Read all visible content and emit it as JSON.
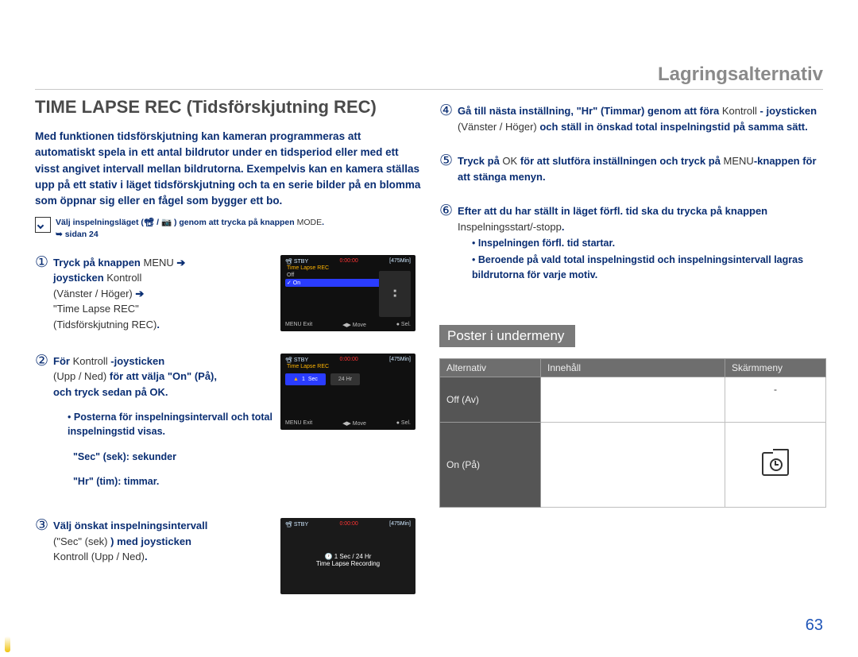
{
  "section_title": "Lagringsalternativ",
  "heading": "TIME LAPSE REC (Tidsförskjutning REC)",
  "intro": "Med funktionen tidsförskjutning kan kameran programmeras att automatiskt spela in ett antal bildrutor under en tidsperiod eller med ett visst angivet intervall mellan bildrutorna. Exempelvis kan en kamera ställas upp på ett stativ i läget tidsförskjutning och ta en serie bilder på en blomma som öppnar sig eller en fågel som bygger ett bo.",
  "note_prefix": "Välj inspelningsläget (",
  "note_mid": " / ",
  "note_suffix": " ) genom att trycka på knappen ",
  "note_mode": "MODE",
  "note_page": "➥ sidan 24",
  "steps": {
    "s1": {
      "a": "Tryck på knappen ",
      "menu": "MENU",
      "b": " ➔ ",
      "c": "joysticken ",
      "d": "Kontroll",
      "e": "(Vänster / Höger)",
      "f": " ➔ ",
      "g": "\"Time Lapse REC\"",
      "h": "(Tidsförskjutning REC)",
      "tail": "."
    },
    "s2": {
      "a": "För ",
      "b": "Kontroll",
      "c": " -joysticken",
      "d": "(Upp / Ned)",
      "e": " för att välja \"On\" (På),",
      "f": "och tryck sedan på OK.",
      "bul1": "Posterna för inspelningsintervall och total inspelningstid visas.",
      "bul2": "\"Sec\" (sek): sekunder",
      "bul3": "\"Hr\" (tim): timmar."
    },
    "s3": {
      "a": "Välj önskat inspelningsintervall",
      "b": "(\"Sec\" (sek)",
      "c": " ) med joysticken",
      "d": "Kontroll (Upp / Ned)",
      "tail": "."
    }
  },
  "right_steps": {
    "s4": {
      "a": "Gå till nästa inställning, \"Hr\" (Timmar) genom att föra ",
      "b": "Kontroll",
      "c": " - joysticken ",
      "d": "(Vänster / Höger)",
      "e": " och ställ in önskad total inspelningstid på samma sätt."
    },
    "s5": {
      "a": "Tryck på ",
      "ok": "OK",
      "b": " för att slutföra inställningen och tryck på ",
      "menu": "MENU",
      "c": "-knappen för att stänga menyn."
    },
    "s6": {
      "a": "Efter att du har ställt in läget förfl. tid ska du trycka på knappen ",
      "rec": "Inspelningsstart/-stopp",
      "tail": ".",
      "bul1": "Inspelningen förfl. tid startar.",
      "bul2": "Beroende på vald total inspelningstid och inspelningsintervall lagras bildrutorna för varje motiv."
    }
  },
  "submenu_label": "Poster i undermeny",
  "table": {
    "h1": "Alternativ",
    "h2": "Innehåll",
    "h3": "Skärmmeny",
    "r1c1": "Off (Av)",
    "r1c2": "",
    "r2c1": "On (På)",
    "r2c2": ""
  },
  "scr": {
    "status_left": "STBY",
    "status_mid": "0:00:00",
    "status_right": "[475Min]",
    "item_tl": "Time Lapse REC",
    "off": "Off",
    "on": "✓ On",
    "sec": "Sec",
    "hr": "Hr",
    "bottom_menu": "MENU Exit",
    "bottom_move": "◀▶ Move",
    "bottom_sel": "● Sel.",
    "stby2": "STBY",
    "time2": "0:00:00",
    "min2": "[475Min]",
    "caption3": "1 Sec / 24 Hr",
    "caption3b": "Time Lapse Recording"
  },
  "page_number": "63"
}
